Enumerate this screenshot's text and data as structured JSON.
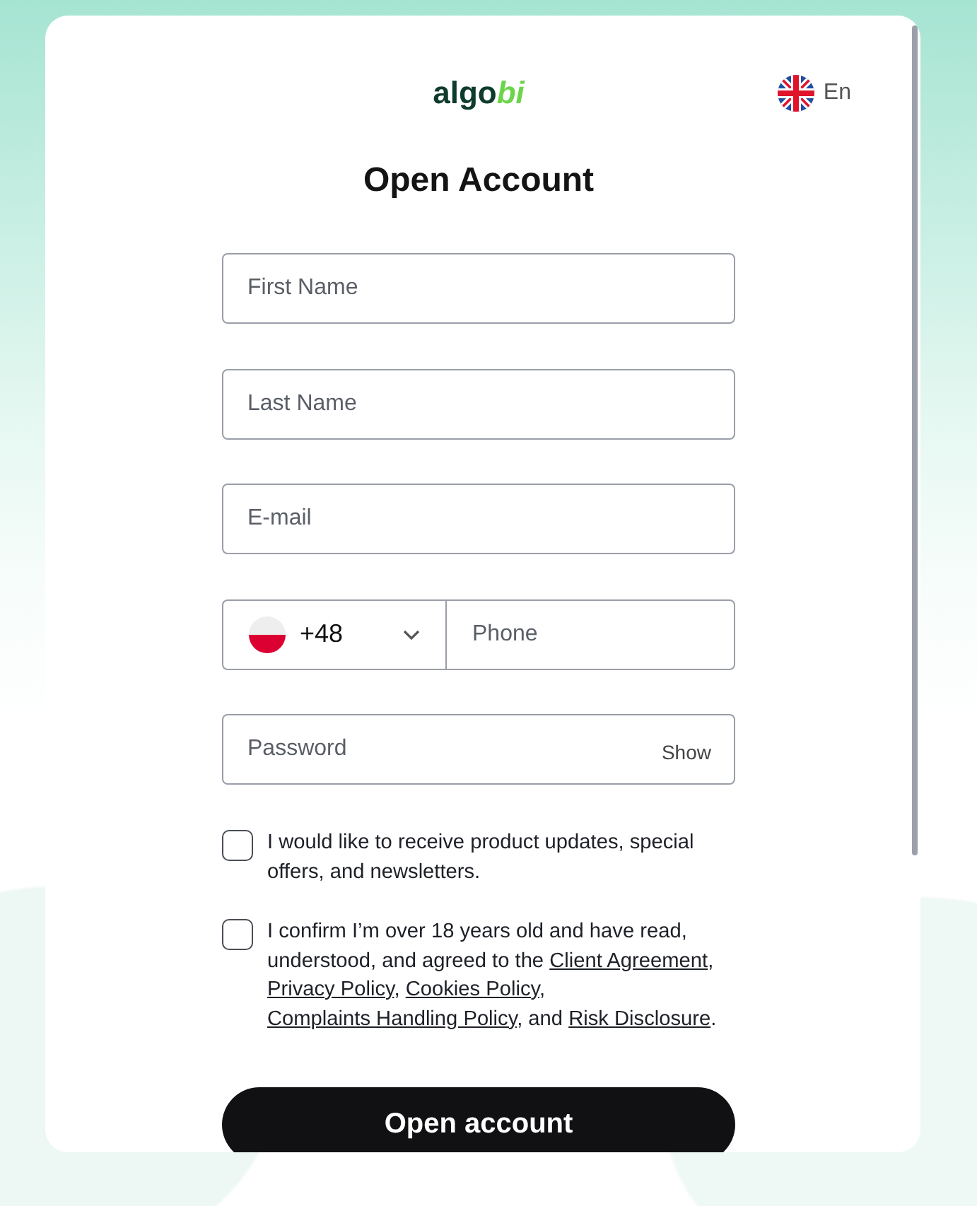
{
  "header": {
    "logo": {
      "main": "algo",
      "accent": "bi"
    },
    "language": {
      "label": "En"
    }
  },
  "title": "Open Account",
  "fields": [
    {
      "kind": "text",
      "placeholder": "First Name"
    },
    {
      "kind": "text",
      "placeholder": "Last Name"
    },
    {
      "kind": "text",
      "placeholder": "E-mail"
    },
    {
      "kind": "phone",
      "country_code": "+48",
      "placeholder": "Phone"
    },
    {
      "kind": "password",
      "placeholder": "Password",
      "toggle": "Show"
    }
  ],
  "consents": [
    {
      "checked": false,
      "parts": [
        {
          "kind": "text",
          "text": "I would like to receive product updates, special offers, and newsletters."
        }
      ]
    },
    {
      "checked": false,
      "parts": [
        {
          "kind": "text",
          "text": "I confirm I’m over 18 years old and have read, understood, and agreed to the "
        },
        {
          "kind": "link",
          "text": "Client Agreement"
        },
        {
          "kind": "text",
          "text": ", "
        },
        {
          "kind": "link",
          "text": "Privacy Policy"
        },
        {
          "kind": "text",
          "text": ", "
        },
        {
          "kind": "link",
          "text": "Cookies Policy"
        },
        {
          "kind": "text",
          "text": ", "
        },
        {
          "kind": "link",
          "text": "Complaints Handling Policy"
        },
        {
          "kind": "text",
          "text": ", and "
        },
        {
          "kind": "link",
          "text": "Risk Disclosure"
        },
        {
          "kind": "text",
          "text": "."
        }
      ]
    }
  ],
  "submit": "Open account"
}
